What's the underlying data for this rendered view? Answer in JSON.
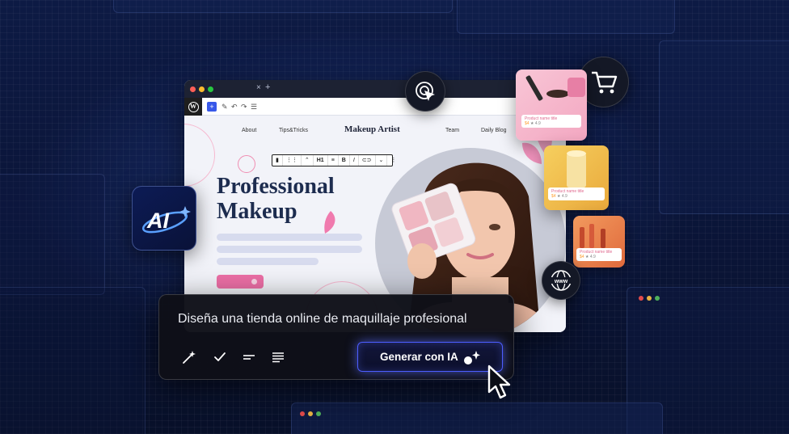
{
  "browser": {
    "tab_close": "×",
    "tab_new": "+",
    "wp_logo": "W"
  },
  "site": {
    "nav": [
      "About",
      "Tips&Tricks",
      "Team",
      "Daily Blog"
    ],
    "brand": "Makeup Artist",
    "heading_line1": "Professional",
    "heading_line2": "Makeup",
    "block_toolbar": [
      "▮",
      "⋮⋮",
      "⌃",
      "H1",
      "≡",
      "B",
      "I",
      "⊂⊃",
      "⌄",
      "⋮"
    ]
  },
  "products": [
    {
      "title": "Product name title",
      "price": "$4",
      "rating": "★ 4.9"
    },
    {
      "title": "Product name title",
      "price": "$4",
      "rating": "★ 4.9"
    },
    {
      "title": "Product name title",
      "price": "$4",
      "rating": "★ 4.9"
    }
  ],
  "ai_chip": {
    "label": "AI"
  },
  "prompt_panel": {
    "prompt_text": "Diseña una tienda online de maquillaje profesional",
    "generate_button": "Generar con IA",
    "tool_icons": [
      "magic-wand-icon",
      "check-icon",
      "short-text-icon",
      "long-text-icon"
    ]
  },
  "colors": {
    "accent_pink": "#ec6fa6",
    "button_glow": "#4d5dff",
    "heading": "#1d2c4f"
  }
}
